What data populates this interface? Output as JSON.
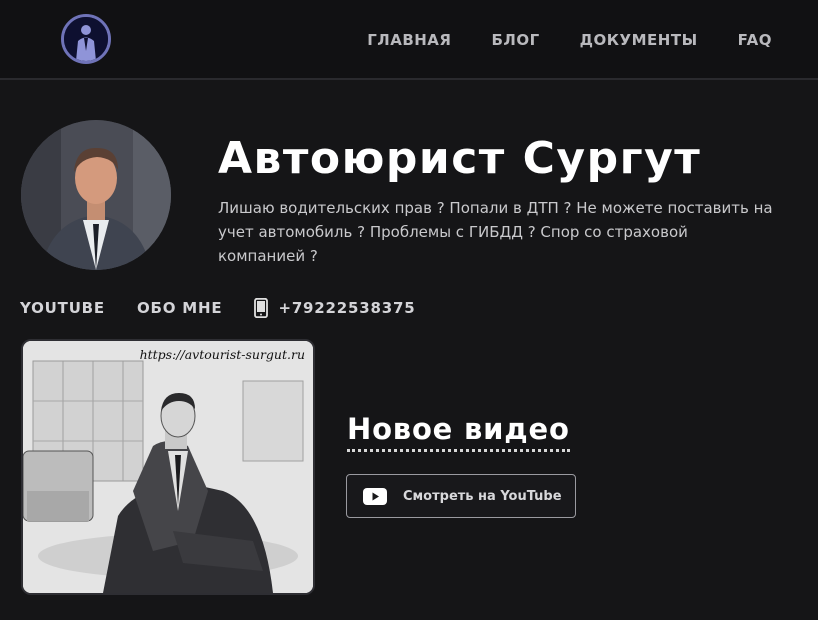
{
  "nav": {
    "items": [
      "ГЛАВНАЯ",
      "БЛОГ",
      "ДОКУМЕНТЫ",
      "FAQ"
    ]
  },
  "profile": {
    "name": "Автоюрист Сургут",
    "description": "Лишаю водительских прав ? Попали в ДТП ? Не можете поставить на учет автомобиль ? Проблемы с ГИБДД ? Спор со страховой компанией ?"
  },
  "links": {
    "youtube": "YOUTUBE",
    "about": "ОБО МНЕ",
    "phone": "+79222538375"
  },
  "video": {
    "thumbnail_url_text": "https://avtourist-surgut.ru",
    "title": "Новое видео",
    "button_label": "Смотреть на YouTube"
  },
  "icons": {
    "logo": "lawyer-silhouette-logo",
    "phone": "mobile-phone-icon",
    "youtube": "youtube-play-icon"
  },
  "colors": {
    "background": "#151517",
    "header": "#111113",
    "logo_ring": "#6f73b8"
  }
}
